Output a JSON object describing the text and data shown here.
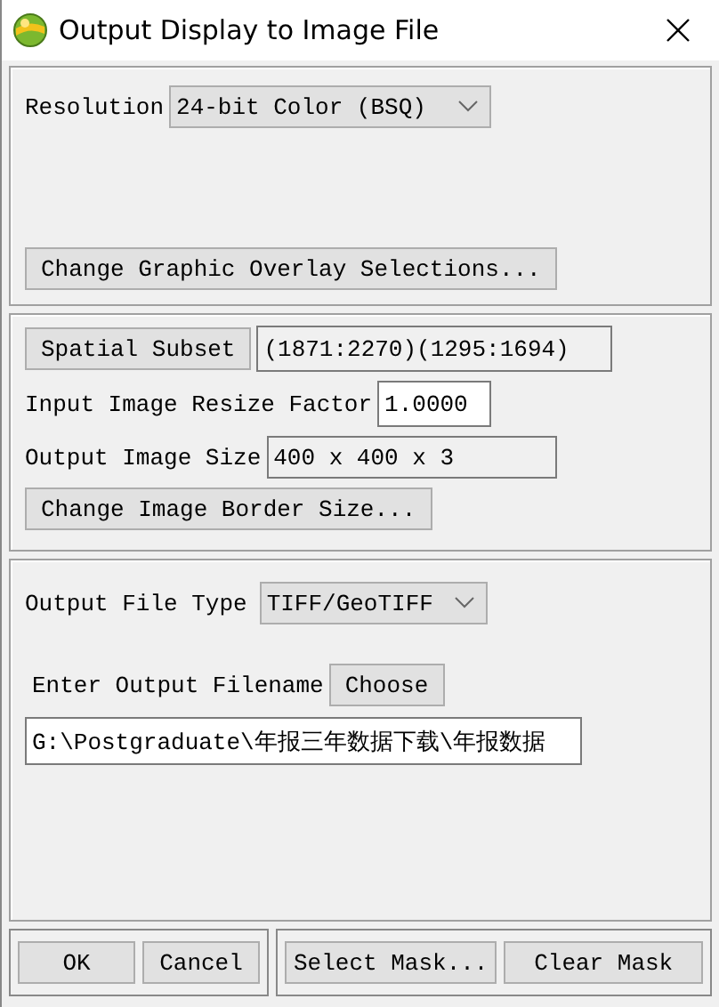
{
  "window": {
    "title": "Output Display to Image File"
  },
  "resolution": {
    "label": "Resolution",
    "value": "24-bit Color (BSQ)"
  },
  "overlay_button": "Change Graphic Overlay Selections...",
  "spatial_subset": {
    "button": "Spatial Subset",
    "value": "(1871:2270)(1295:1694)",
    "readonly": true
  },
  "resize_factor": {
    "label": "Input Image Resize Factor",
    "value": "1.0000",
    "readonly": false
  },
  "output_size": {
    "label": "Output Image Size",
    "value": "400 x 400 x 3",
    "readonly": true
  },
  "border_button": "Change Image Border Size...",
  "file_type": {
    "label": "Output File Type",
    "value": "TIFF/GeoTIFF"
  },
  "filename": {
    "label": "Enter Output Filename",
    "button": "Choose",
    "value": "G:\\Postgraduate\\年报三年数据下载\\年报数据",
    "readonly": false
  },
  "button_groups": [
    [
      "OK",
      "Cancel"
    ],
    [
      "Select Mask...",
      "Clear Mask"
    ]
  ]
}
